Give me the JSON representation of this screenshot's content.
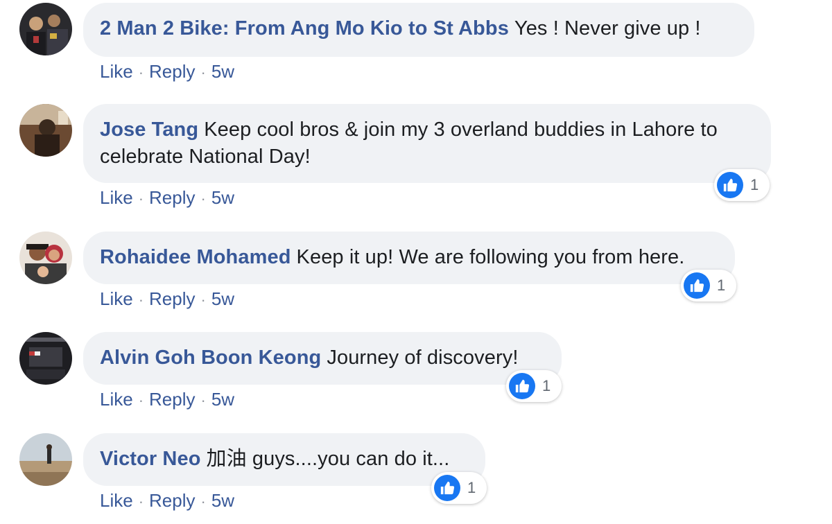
{
  "colors": {
    "bubble": "#f0f2f5",
    "author": "#385898",
    "like_blue": "#1877f2"
  },
  "comments": [
    {
      "author": "2 Man 2 Bike: From Ang Mo Kio to St Abbs",
      "text": "Yes ! Never give up !",
      "like_label": "Like",
      "reply_label": "Reply",
      "time": "5w"
    },
    {
      "author": "Jose Tang",
      "text": "Keep cool bros & join my 3 overland buddies in Lahore to celebrate National Day!",
      "like_label": "Like",
      "reply_label": "Reply",
      "time": "5w",
      "reaction_icon": "thumbs-up-icon",
      "reaction_count": "1"
    },
    {
      "author": "Rohaidee Mohamed",
      "text": "Keep it up! We are following you from here.",
      "like_label": "Like",
      "reply_label": "Reply",
      "time": "5w",
      "reaction_icon": "thumbs-up-icon",
      "reaction_count": "1"
    },
    {
      "author": "Alvin Goh Boon Keong",
      "text": "Journey of discovery!",
      "like_label": "Like",
      "reply_label": "Reply",
      "time": "5w",
      "reaction_icon": "thumbs-up-icon",
      "reaction_count": "1"
    },
    {
      "author": "Victor Neo",
      "text": "加油 guys....you can do it...",
      "like_label": "Like",
      "reply_label": "Reply",
      "time": "5w",
      "reaction_icon": "thumbs-up-icon",
      "reaction_count": "1"
    }
  ],
  "separator": "·"
}
